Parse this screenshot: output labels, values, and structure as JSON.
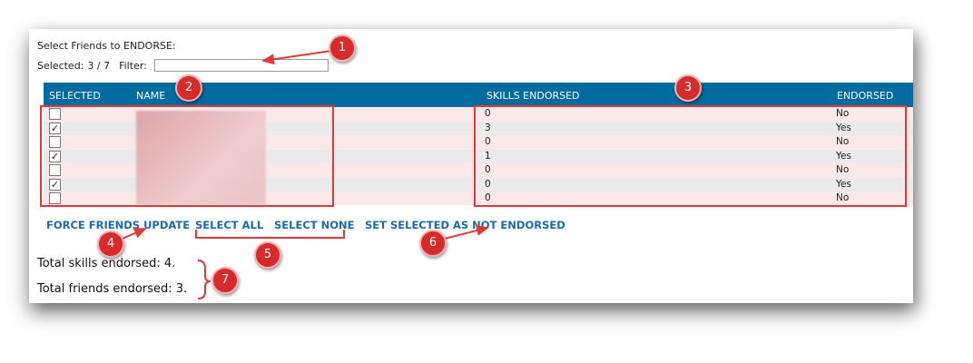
{
  "header": {
    "title": "Select Friends to ENDORSE:",
    "selected_label": "Selected:",
    "selected_value": "3 / 7",
    "filter_label": "Filter:",
    "filter_value": ""
  },
  "grid": {
    "columns": [
      "SELECTED",
      "NAME",
      "SKILLS ENDORSED",
      "ENDORSED"
    ],
    "rows": [
      {
        "selected": false,
        "skills": "0",
        "endorsed": "No"
      },
      {
        "selected": true,
        "skills": "3",
        "endorsed": "Yes"
      },
      {
        "selected": false,
        "skills": "0",
        "endorsed": "No"
      },
      {
        "selected": true,
        "skills": "1",
        "endorsed": "Yes"
      },
      {
        "selected": false,
        "skills": "0",
        "endorsed": "No"
      },
      {
        "selected": true,
        "skills": "0",
        "endorsed": "Yes"
      },
      {
        "selected": false,
        "skills": "0",
        "endorsed": "No"
      }
    ]
  },
  "actions": {
    "force_update": "FORCE FRIENDS UPDATE",
    "select_all": "SELECT ALL",
    "select_none": "SELECT NONE",
    "set_not_endorsed": "SET SELECTED AS NOT ENDORSED"
  },
  "totals": {
    "skills": "Total skills endorsed: 4.",
    "friends": "Total friends endorsed: 3."
  },
  "annotations": [
    "1",
    "2",
    "3",
    "4",
    "5",
    "6",
    "7"
  ],
  "colors": {
    "header_bg": "#006b9e",
    "link": "#1c6aa6",
    "annotation_red": "#d62b2b"
  }
}
